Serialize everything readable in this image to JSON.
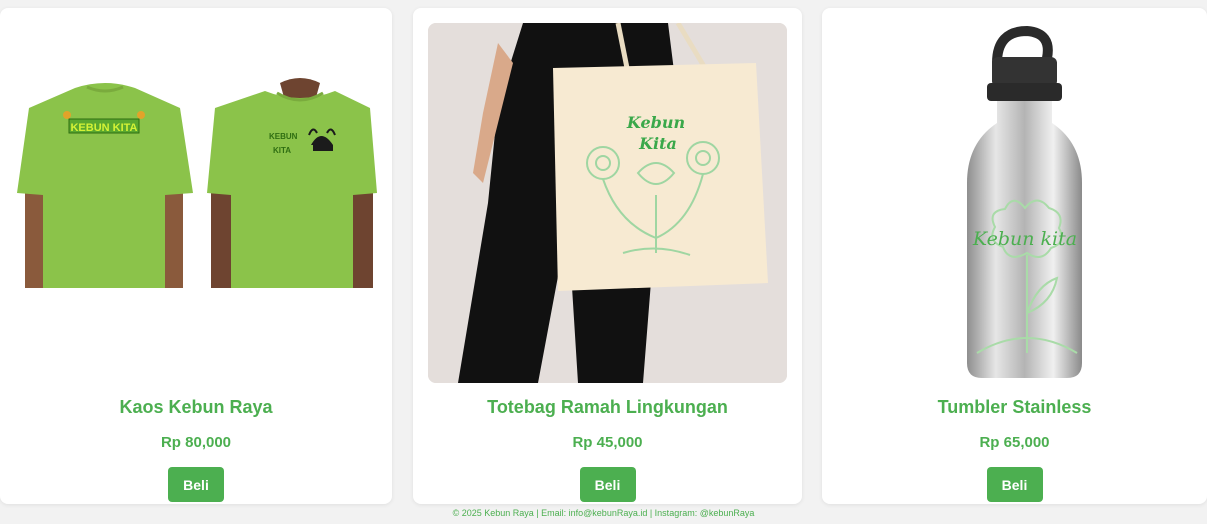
{
  "products": [
    {
      "name": "Kaos Kebun Raya",
      "price": "Rp 80,000",
      "buy_label": "Beli",
      "print_front": "KEBUN KITA",
      "print_pocket_1": "KEBUN",
      "print_pocket_2": "KITA",
      "image": "green-tshirt-image"
    },
    {
      "name": "Totebag Ramah Lingkungan",
      "price": "Rp 45,000",
      "buy_label": "Beli",
      "print_1": "Kebun",
      "print_2": "Kita",
      "image": "tote-bag-image"
    },
    {
      "name": "Tumbler Stainless",
      "price": "Rp 65,000",
      "buy_label": "Beli",
      "print": "Kebun kita",
      "image": "steel-bottle-image"
    }
  ],
  "footer": {
    "text": "© 2025 Kebun Raya | Email: info@kebunRaya.id | Instagram: @kebunRaya"
  },
  "colors": {
    "accent": "#4caf50",
    "shirt_green": "#8bc34a",
    "tote_canvas": "#f7ead2"
  }
}
